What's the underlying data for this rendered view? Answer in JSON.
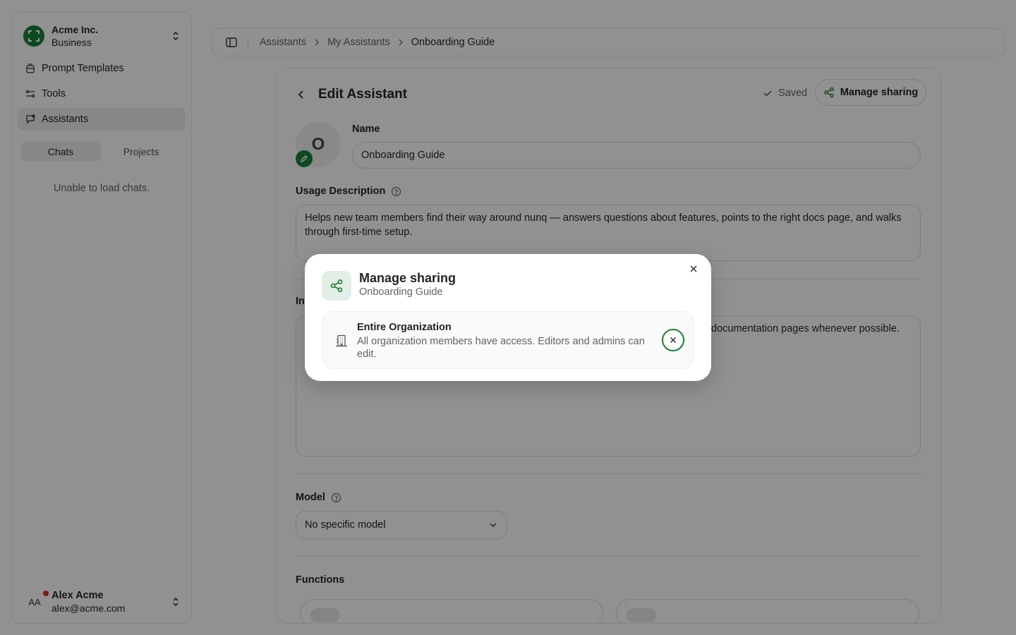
{
  "org": {
    "name": "Acme Inc.",
    "plan": "Business"
  },
  "nav": {
    "items": [
      {
        "label": "Prompt Templates",
        "icon": "prompt-templates-icon"
      },
      {
        "label": "Tools",
        "icon": "tools-icon"
      },
      {
        "label": "Assistants",
        "icon": "assistants-icon",
        "active": true
      }
    ]
  },
  "tabs": {
    "chats": "Chats",
    "projects": "Projects"
  },
  "chats_empty": "Unable to load chats.",
  "user": {
    "initials": "AA",
    "name": "Alex Acme",
    "email": "alex@acme.com"
  },
  "breadcrumb": {
    "items": [
      "Assistants",
      "My Assistants",
      "Onboarding Guide"
    ]
  },
  "editor": {
    "title": "Edit Assistant",
    "saved_label": "Saved",
    "share_button": "Manage sharing",
    "avatar_letter": "O",
    "name_label": "Name",
    "name_value": "Onboarding Guide",
    "usage_label": "Usage Description",
    "usage_value": "Helps new team members find their way around nunq — answers questions about features, points to the right docs page, and walks through first-time setup.",
    "instructions_label_partial": "In",
    "instructions_value_partial": "documentation pages whenever possible.",
    "model_label": "Model",
    "model_value": "No specific model",
    "functions_label": "Functions"
  },
  "modal": {
    "title": "Manage sharing",
    "subtitle": "Onboarding Guide",
    "row_title": "Entire Organization",
    "row_desc": "All organization members have access. Editors and admins can edit."
  },
  "colors": {
    "accent": "#1a7f37",
    "overlay": "rgba(0,0,0,0.42)"
  }
}
